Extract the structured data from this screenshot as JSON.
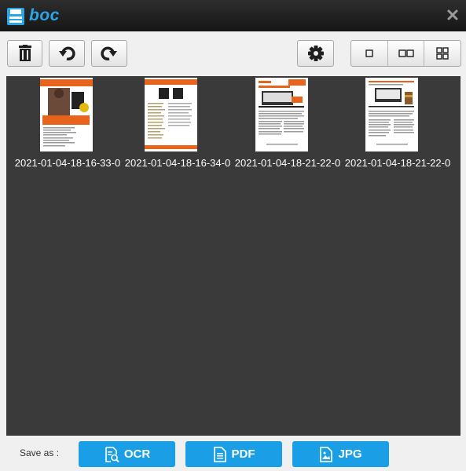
{
  "app": {
    "title": "boc",
    "accent": "#1a9fe6"
  },
  "toolbar": {
    "buttons": [
      {
        "name": "delete",
        "icon": "trash-icon"
      },
      {
        "name": "rotate-left",
        "icon": "rotate-left-icon"
      },
      {
        "name": "rotate-right",
        "icon": "rotate-right-icon"
      },
      {
        "name": "settings",
        "icon": "gear-icon"
      }
    ],
    "view_modes": [
      "single-view-icon",
      "double-view-icon",
      "grid-view-icon"
    ]
  },
  "files": [
    {
      "label": "2021-01-04-18-16-33-0"
    },
    {
      "label": "2021-01-04-18-16-34-0"
    },
    {
      "label": "2021-01-04-18-21-22-0"
    },
    {
      "label": "2021-01-04-18-21-22-0"
    }
  ],
  "footer": {
    "save_as_label": "Save as :",
    "buttons": [
      {
        "label": "OCR",
        "icon": "ocr-icon"
      },
      {
        "label": "PDF",
        "icon": "pdf-icon"
      },
      {
        "label": "JPG",
        "icon": "jpg-icon"
      }
    ]
  }
}
